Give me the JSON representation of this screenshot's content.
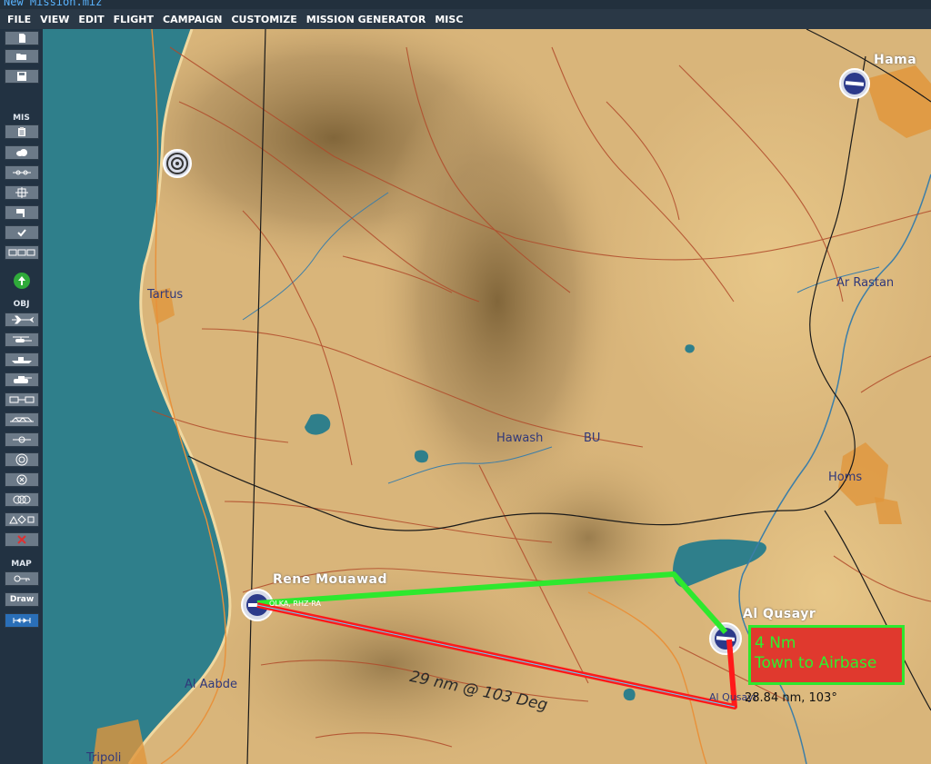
{
  "window": {
    "title": "New Mission.miz"
  },
  "menu": [
    "FILE",
    "VIEW",
    "EDIT",
    "FLIGHT",
    "CAMPAIGN",
    "CUSTOMIZE",
    "MISSION GENERATOR",
    "MISC"
  ],
  "sidebar": {
    "sections": {
      "mis": "MIS",
      "obj": "OBJ",
      "map": "MAP"
    },
    "draw_label": "Draw"
  },
  "map": {
    "towns": {
      "tartus": "Tartus",
      "ar_rastan": "Ar Rastan",
      "hawash": "Hawash",
      "bu": "BU",
      "homs": "Homs",
      "al_aabde": "Al Aabde",
      "tripoli": "Tripoli",
      "al_qusayr_town": "Al Qusayr"
    },
    "airbases": {
      "hama": "Hama",
      "rene_mouawad": "Rene Mouawad",
      "al_qusayr": "Al Qusayr"
    },
    "airbase_code": "OLKA, RHZ-RA",
    "ruler_label": "29 nm @ 103 Deg",
    "ruler_readout": "28.84 nm, 103°",
    "annotation": {
      "line1": "4 Nm",
      "line2": "Town to Airbase"
    },
    "colors": {
      "land": "#d9b57a",
      "sea": "#2f7f8b",
      "highland": "#8f7346",
      "roads": "#b04a2a",
      "rail": "#1a1a1a",
      "route_green": "#2ee82e",
      "route_red": "#ff1a1a",
      "annotation_fill": "#e0392e"
    }
  }
}
